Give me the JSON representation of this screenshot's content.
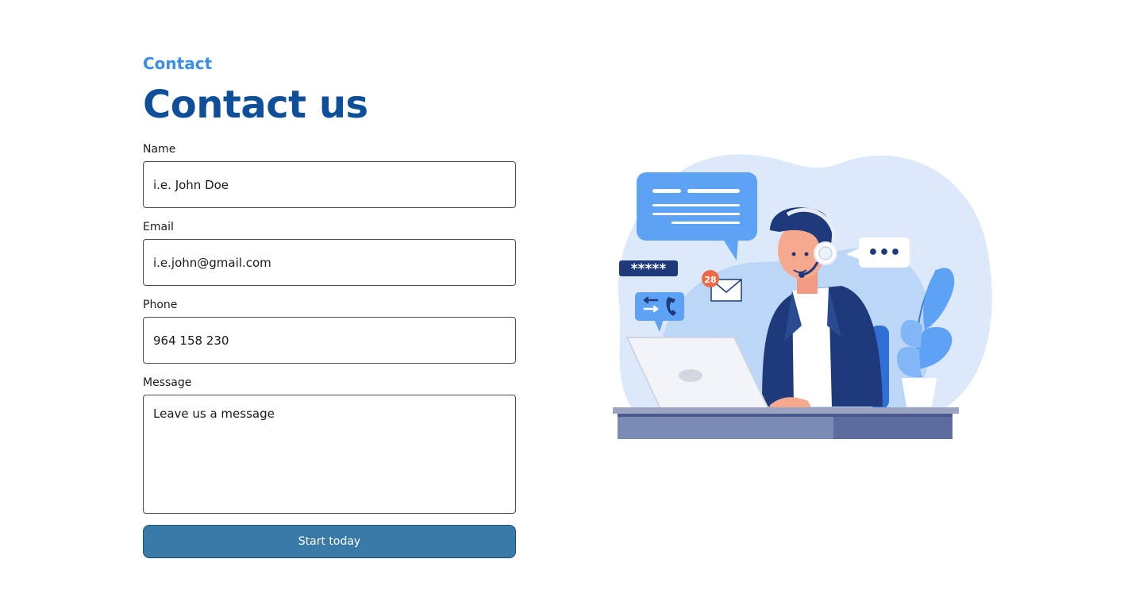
{
  "header": {
    "eyebrow": "Contact",
    "title": "Contact us"
  },
  "form": {
    "name": {
      "label": "Name",
      "placeholder": "i.e. John Doe"
    },
    "email": {
      "label": "Email",
      "placeholder": "i.e.john@gmail.com"
    },
    "phone": {
      "label": "Phone",
      "placeholder": "964 158 230"
    },
    "message": {
      "label": "Message",
      "placeholder": "Leave us a message"
    },
    "submit_label": "Start today"
  },
  "illustration": {
    "password_mask": "*****",
    "notification_count": "28",
    "speech_dots": "•••"
  },
  "colors": {
    "accent": "#3b8ee6",
    "title": "#0f4f9a",
    "button": "#3a7aa8"
  }
}
